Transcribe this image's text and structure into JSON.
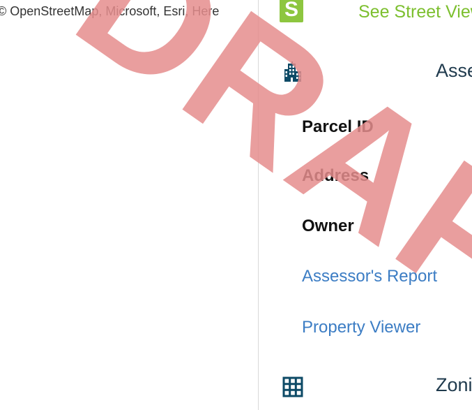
{
  "map": {
    "attribution": "© OpenStreetMap, Microsoft, Esri, Here"
  },
  "panel": {
    "street_view": {
      "logo_letter": "S",
      "link_label": "See Street View"
    },
    "assessor": {
      "icon": "building-icon",
      "title": "Assessor",
      "fields": [
        {
          "label": "Parcel ID"
        },
        {
          "label": "Address"
        },
        {
          "label": "Owner"
        }
      ],
      "links": [
        {
          "label": "Assessor's Report"
        },
        {
          "label": "Property Viewer"
        }
      ]
    },
    "zoning": {
      "icon": "grid-icon",
      "title": "Zoning"
    }
  },
  "watermark": {
    "text": "DRAFT"
  },
  "colors": {
    "street_view_green": "#7cbf2e",
    "logo_green": "#8dc63f",
    "link_blue": "#3c7dc4",
    "section_title": "#1f3a4d",
    "icon_color": "#0d4a66",
    "watermark_red": "#e58d8d"
  }
}
